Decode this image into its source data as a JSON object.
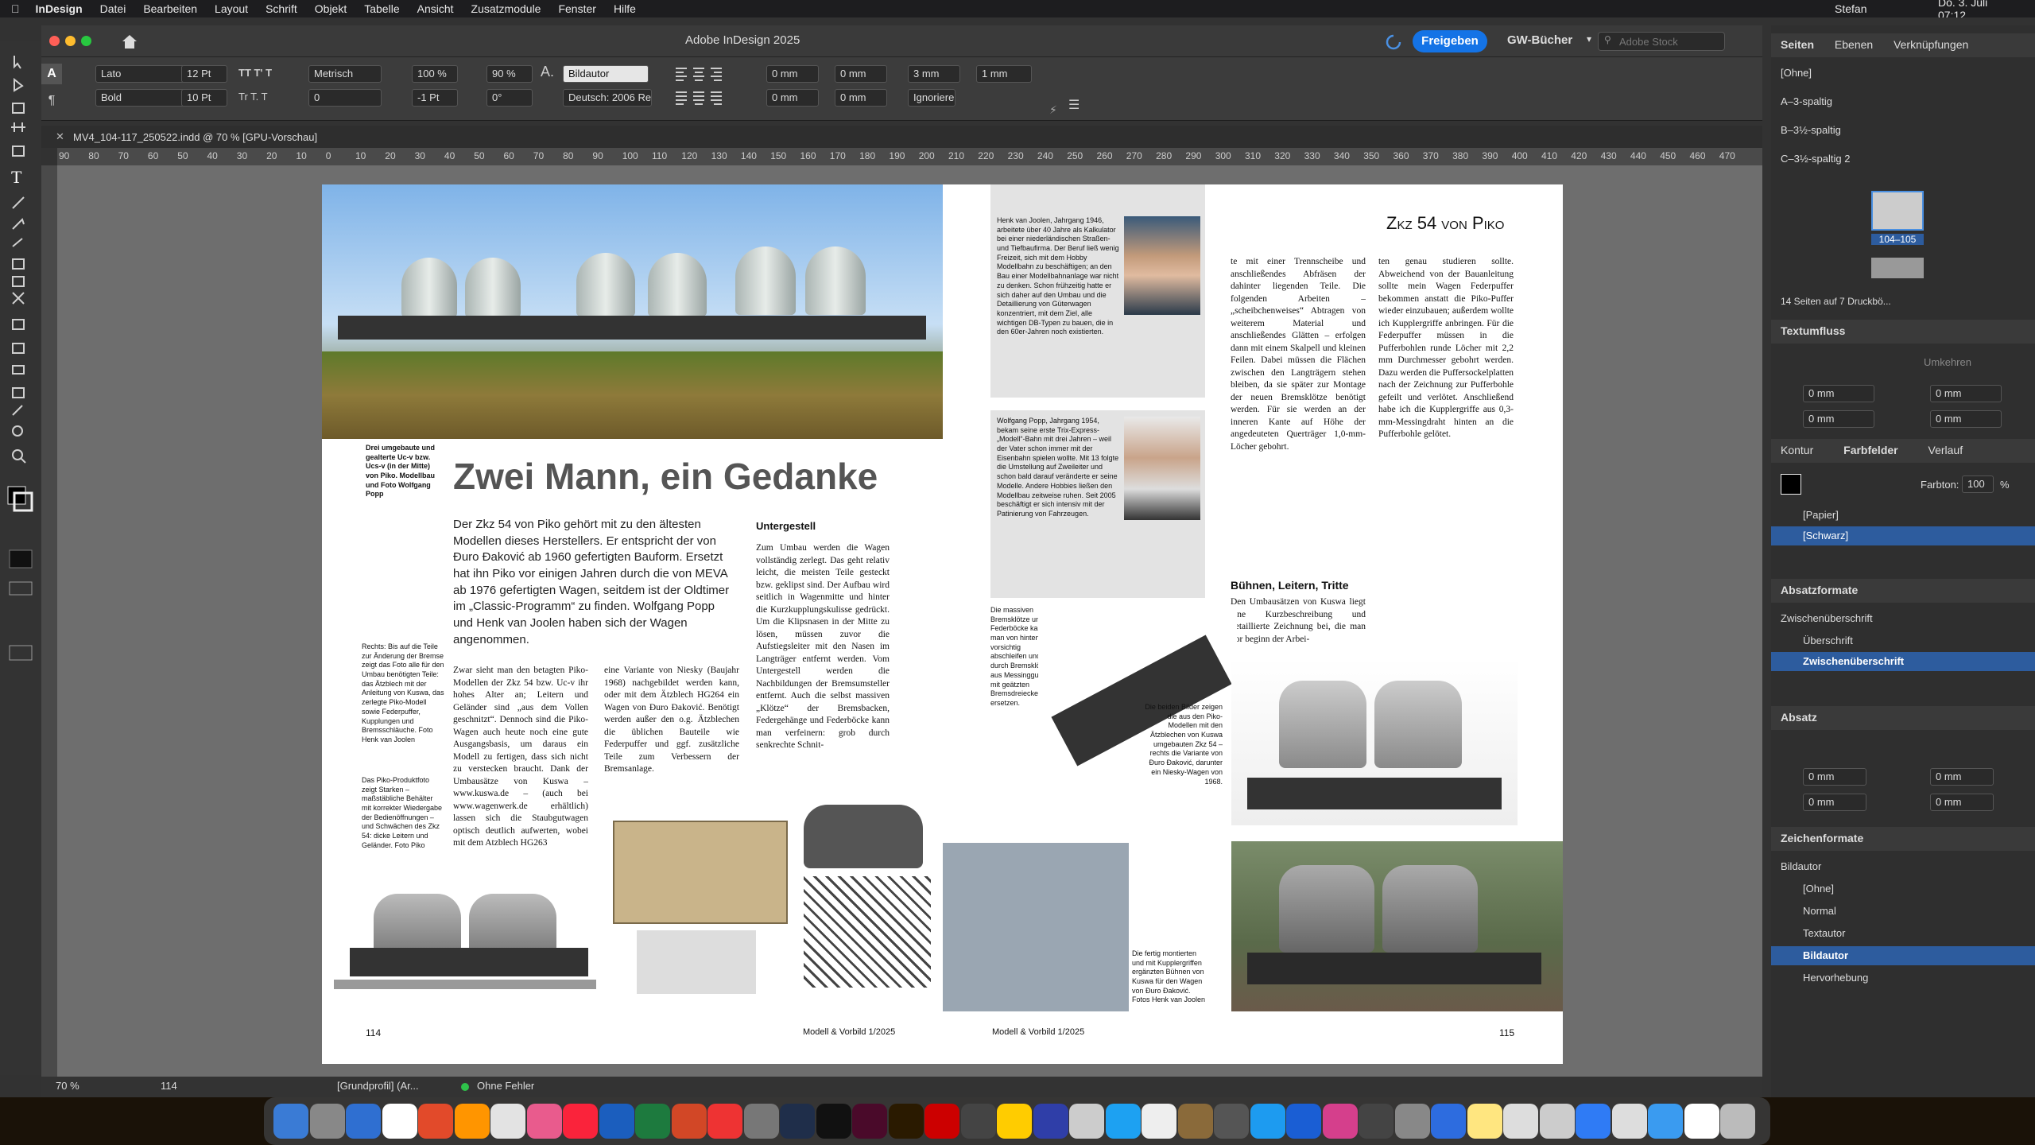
{
  "menubar": {
    "app": "InDesign",
    "items": [
      "Datei",
      "Bearbeiten",
      "Layout",
      "Schrift",
      "Objekt",
      "Tabelle",
      "Ansicht",
      "Zusatzmodule",
      "Fenster",
      "Hilfe"
    ],
    "user": "Stefan",
    "clock": "Do. 3. Juli 07:12"
  },
  "window": {
    "title": "Adobe InDesign 2025",
    "share": "Freigeben",
    "workspace": "GW-Bücher",
    "stock_placeholder": "Adobe Stock"
  },
  "control": {
    "font": "Lato",
    "style": "Bold",
    "size": "12 Pt",
    "leading": "10 Pt",
    "kerning": "Metrisch",
    "tracking": "0",
    "hscale": "100 %",
    "vscale": "90 %",
    "baseline": "-1 Pt",
    "skew": "0°",
    "charstyle": "Bildautor",
    "lang": "Deutsch: 2006 Rechtschr...",
    "indent1": "0 mm",
    "indent2": "0 mm",
    "indent3": "0 mm",
    "indent4": "0 mm",
    "space1": "3 mm",
    "space2": "1 mm",
    "ignore": "Ignorieren"
  },
  "tab": {
    "title": "MV4_104-117_250522.indd @ 70 % [GPU-Vorschau]"
  },
  "ruler": {
    "labels": [
      "90",
      "80",
      "70",
      "60",
      "50",
      "40",
      "30",
      "20",
      "10",
      "0",
      "10",
      "20",
      "30",
      "40",
      "50",
      "60",
      "70",
      "80",
      "90",
      "100",
      "110",
      "120",
      "130",
      "140",
      "150",
      "160",
      "170",
      "180",
      "190",
      "200",
      "210",
      "220",
      "230",
      "240",
      "250",
      "260",
      "270",
      "280",
      "290",
      "300",
      "310",
      "320",
      "330",
      "340",
      "350",
      "360",
      "370",
      "380",
      "390",
      "400",
      "410",
      "420",
      "430",
      "440",
      "450",
      "460",
      "470"
    ]
  },
  "status": {
    "zoom": "70 %",
    "page": "114",
    "profile": "[Grundprofil] (Ar...",
    "errors": "Ohne Fehler"
  },
  "panel": {
    "tabs": [
      "Seiten",
      "Ebenen",
      "Verknüpfungen"
    ],
    "masters": [
      "[Ohne]",
      "A–3-spaltig",
      "B–3½-spaltig",
      "C–3½-spaltig 2"
    ],
    "spread_label": "104–105",
    "pages_info": "14 Seiten auf 7 Druckbö...",
    "textflow": "Textumfluss",
    "wrap_invert": "Umkehren",
    "wrap_vals": [
      "0 mm",
      "0 mm",
      "0 mm",
      "0 mm"
    ],
    "swatch_tabs": [
      "Kontur",
      "Farbfelder",
      "Verlauf"
    ],
    "tint_label": "Farbton:",
    "tint": "100",
    "tint_unit": "%",
    "swatches": [
      "[Papier]",
      "[Schwarz]"
    ],
    "para_styles_title": "Absatzformate",
    "para_current": "Zwischenüberschrift",
    "para_items": [
      "Überschrift",
      "Zwischenüberschrift"
    ],
    "paragraph_title": "Absatz",
    "para_vals": [
      "0 mm",
      "0 mm",
      "0 mm",
      "0 mm"
    ],
    "char_styles_title": "Zeichenformate",
    "char_current": "Bildautor",
    "char_items": [
      "[Ohne]",
      "Normal",
      "Textautor",
      "Bildautor",
      "Hervorhebung"
    ]
  },
  "left_page": {
    "caption1": "Drei umgebaute und gealterte Uc-v bzw. Ucs-v (in der Mitte) von Piko. Modellbau und Foto Wolfgang Popp",
    "headline": "Zwei Mann, ein Gedanke",
    "intro": "Der Zkz 54 von Piko gehört mit zu den ältesten Modellen dieses Herstellers. Er entspricht der von Ðuro Ðaković ab 1960 gefertigten Bauform. Ersetzt hat ihn Piko vor einigen Jahren durch die von MEVA ab 1976 gefertigten Wagen, seitdem ist der Oldtimer im „Classic-Programm“ zu finden. Wolfgang Popp und Henk van Joolen haben sich der Wagen angenommen.",
    "subhead": "Untergestell",
    "col1": "Zwar sieht man den betagten Piko-Modellen der Zkz 54 bzw. Uc-v ihr hohes Alter an; Leitern und Geländer sind „aus dem Vollen geschnitzt“. Dennoch sind die Piko-Wagen auch heute noch eine gute Ausgangsbasis, um daraus ein Modell zu fertigen, dass sich nicht zu verstecken braucht. Dank der Umbausätze von Kuswa – www.kuswa.de – (auch bei www.wagenwerk.de erhältlich) lassen sich die Staubgutwagen optisch deutlich aufwerten, wobei mit dem Atzblech HG263",
    "col2": "eine Variante von Niesky (Baujahr 1968) nachgebildet werden kann, oder mit dem Ätzblech HG264 ein Wagen von Ðuro Ðaković. Benötigt werden außer den o.g. Ätzblechen die üblichen Bauteile wie Federpuffer und ggf. zusätzliche Teile zum Verbessern der Bremsanlage.",
    "col3": "Zum Umbau werden die Wagen vollständig zerlegt. Das geht relativ leicht, die meisten Teile gesteckt bzw. geklipst sind. Der Aufbau wird seitlich in Wagenmitte und hinter die Kurzkupplungskulisse gedrückt. Um die Klipsnasen in der Mitte zu lösen, müssen zuvor die Aufstiegsleiter mit den Nasen im Langträger entfernt werden. Vom Untergestell werden die Nachbildungen der Bremsumsteller entfernt. Auch die selbst massiven „Klötze“ der Bremsbacken, Federgehänge und Federböcke kann man verfeinern: grob durch senkrechte Schnit-",
    "caption2": "Rechts: Bis auf die Teile zur Änderung der Bremse zeigt das Foto alle für den Umbau benötigten Teile: das Ätzblech mit der Anleitung von Kuswa, das zerlegte Piko-Modell sowie Federpuffer, Kupplungen und Bremsschläuche. Foto Henk van Joolen",
    "caption3": "Das Piko-Produktfoto zeigt Starken – maßstäbliche Behälter mit korrekter Wiedergabe der Bedienöffnungen – und Schwächen des Zkz 54: dicke Leitern und Geländer. Foto Piko",
    "folio": "114",
    "footer": "Modell & Vorbild 1/2025"
  },
  "right_page": {
    "bio1": "Henk van Joolen, Jahrgang 1946, arbeitete über 40 Jahre als Kalkulator bei einer niederländischen Straßen- und Tiefbaufirma. Der Beruf ließ wenig Freizeit, sich mit dem Hobby Modellbahn zu beschäftigen; an den Bau einer Modellbahnanlage war nicht zu denken. Schon frühzeitig hatte er sich daher auf den Umbau und die Detaillierung von Güterwagen konzentriert, mit dem Ziel, alle wichtigen DB-Typen zu bauen, die in den 60er-Jahren noch existierten.",
    "bio2": "Wolfgang Popp, Jahrgang 1954, bekam seine erste Trix-Express-„Modell“-Bahn mit drei Jahren – weil der Vater schon immer mit der Eisenbahn spielen wollte. Mit 13 folgte die Umstellung auf Zweileiter und schon bald darauf veränderte er seine Modelle. Andere Hobbies ließen den Modellbau zeitweise ruhen. Seit 2005 beschäftigt er sich intensiv mit der Patinierung von Fahrzeugen.",
    "title": "Zkz 54 von Piko",
    "colA": "te mit einer Trennscheibe und anschließendes Abfräsen der dahinter liegenden Teile. Die folgenden Arbeiten – „scheibchenweises“ Abtragen von weiterem Material und anschließendes Glätten – erfolgen dann mit einem Skalpell und kleinen Feilen. Dabei müssen die Flächen zwischen den Langträgern stehen bleiben, da sie später zur Montage der neuen Bremsklötze benötigt werden. Für sie werden an der inneren Kante auf Höhe der angedeuteten Querträger 1,0-mm-Löcher gebohrt.",
    "subhead2": "Bühnen, Leitern, Tritte",
    "colA2": "Den Umbausätzen von Kuswa liegt eine Kurzbeschreibung und detaillierte Zeichnung bei, die man vor beginn der Arbei-",
    "colB": "ten genau studieren sollte. Abweichend von der Bauanleitung sollte mein Wagen Federpuffer bekommen anstatt die Piko-Puffer wieder einzubauen; außerdem wollte ich Kupplergriffe anbringen. Für die Federpuffer müssen in die Pufferbohlen runde Löcher mit 2,2 mm Durchmesser gebohrt werden. Dazu werden die Puffersockelplatten nach der Zeichnung zur Pufferbohle gefeilt und verlötet. Anschließend habe ich die Kupplergriffe aus 0,3-mm-Messingdraht hinten an die Pufferbohle gelötet.",
    "caption4": "Die massiven Bremsklötze und Federböcke kann man von hinten vorsichtig abschleifen und durch Bremsklötze aus Messingguss mit geätzten Bremsdreiecken ersetzen.",
    "caption5": "Die beiden Bilder zeigen die aus den Piko-Modellen mit den Ätzblechen von Kuswa umgebauten Zkz 54 – rechts die Variante von Ðuro Ðaković, darunter ein Niesky-Wagen von 1968.",
    "caption6": "Die fertig montierten und mit Kupplergriffen ergänzten Bühnen von Kuswa für den Wagen von Ðuro Ðaković. Fotos Henk van Joolen",
    "folio": "115",
    "footer": "Modell & Vorbild 1/2025"
  },
  "colors": {
    "accent": "#1473e6",
    "selected": "#2d5c9e",
    "pasteboard": "#6e6e6e"
  }
}
